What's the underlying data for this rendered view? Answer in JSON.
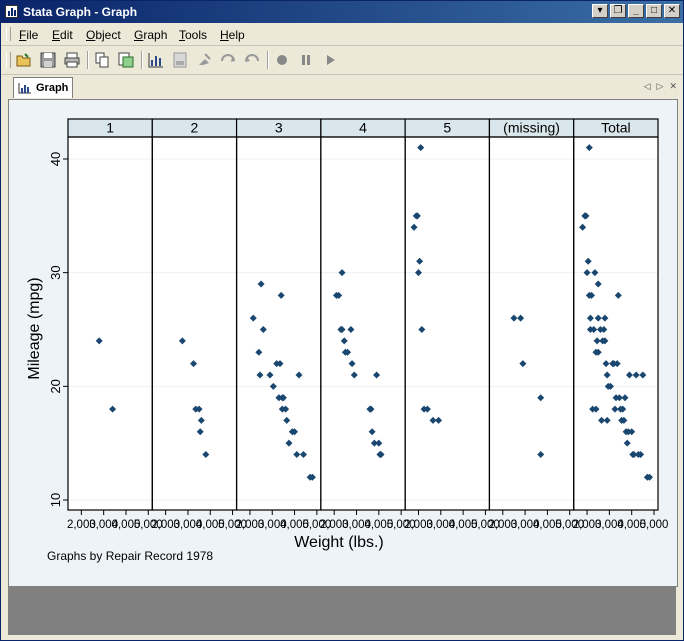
{
  "window": {
    "title": "Stata Graph - Graph"
  },
  "menu": [
    {
      "label": "File",
      "u": "F",
      "rest": "ile"
    },
    {
      "label": "Edit",
      "u": "E",
      "rest": "dit"
    },
    {
      "label": "Object",
      "u": "O",
      "rest": "bject"
    },
    {
      "label": "Graph",
      "u": "G",
      "rest": "raph"
    },
    {
      "label": "Tools",
      "u": "T",
      "rest": "ools"
    },
    {
      "label": "Help",
      "u": "H",
      "rest": "elp"
    }
  ],
  "tab": {
    "label": "Graph"
  },
  "graph": {
    "note": "Graphs by Repair Record 1978"
  },
  "chart_data": {
    "type": "scatter",
    "xlabel": "Weight (lbs.)",
    "ylabel": "Mileage (mpg)",
    "xlim": [
      1760,
      5000
    ],
    "ylim": [
      10,
      41
    ],
    "yticks": [
      10,
      20,
      30,
      40
    ],
    "xticks": [
      2000,
      3000,
      4000,
      5000
    ],
    "xtick_labels": [
      "2,000",
      "3,000",
      "4,000",
      "5,000"
    ],
    "panels": [
      {
        "label": "1",
        "points": [
          [
            2800,
            24
          ],
          [
            3400,
            18
          ]
        ]
      },
      {
        "label": "2",
        "points": [
          [
            2750,
            24
          ],
          [
            3250,
            22
          ],
          [
            3350,
            18
          ],
          [
            3500,
            18
          ],
          [
            3600,
            17
          ],
          [
            3550,
            16
          ],
          [
            3800,
            14
          ]
        ]
      },
      {
        "label": "3",
        "points": [
          [
            2150,
            26
          ],
          [
            2400,
            23
          ],
          [
            2450,
            21
          ],
          [
            2600,
            25
          ],
          [
            2500,
            29
          ],
          [
            2900,
            21
          ],
          [
            3050,
            20
          ],
          [
            3200,
            22
          ],
          [
            3350,
            22
          ],
          [
            3400,
            28
          ],
          [
            3300,
            19
          ],
          [
            3450,
            19
          ],
          [
            3500,
            19
          ],
          [
            3600,
            18
          ],
          [
            3450,
            18
          ],
          [
            3650,
            17
          ],
          [
            3750,
            15
          ],
          [
            3900,
            16
          ],
          [
            4000,
            16
          ],
          [
            4100,
            14
          ],
          [
            4200,
            21
          ],
          [
            4400,
            14
          ],
          [
            4700,
            12
          ],
          [
            4800,
            12
          ]
        ]
      },
      {
        "label": "4",
        "points": [
          [
            2100,
            28
          ],
          [
            2200,
            28
          ],
          [
            2300,
            25
          ],
          [
            2350,
            25
          ],
          [
            2450,
            24
          ],
          [
            2500,
            23
          ],
          [
            2600,
            23
          ],
          [
            2750,
            25
          ],
          [
            2800,
            22
          ],
          [
            2900,
            21
          ],
          [
            2350,
            30
          ],
          [
            3600,
            18
          ],
          [
            3650,
            18
          ],
          [
            3700,
            16
          ],
          [
            3800,
            15
          ],
          [
            3900,
            21
          ],
          [
            4000,
            15
          ],
          [
            4050,
            14
          ],
          [
            4100,
            14
          ]
        ]
      },
      {
        "label": "5",
        "points": [
          [
            1800,
            34
          ],
          [
            1900,
            35
          ],
          [
            1950,
            35
          ],
          [
            2050,
            31
          ],
          [
            2000,
            30
          ],
          [
            2150,
            25
          ],
          [
            2250,
            18
          ],
          [
            2400,
            18
          ],
          [
            2650,
            17
          ],
          [
            2900,
            17
          ],
          [
            2100,
            41
          ]
        ]
      },
      {
        "label": "(missing)",
        "points": [
          [
            2500,
            26
          ],
          [
            2800,
            26
          ],
          [
            2900,
            22
          ],
          [
            3700,
            19
          ],
          [
            3700,
            14
          ]
        ]
      },
      {
        "label": "Total",
        "points": [
          [
            1800,
            34
          ],
          [
            1900,
            35
          ],
          [
            1950,
            35
          ],
          [
            2050,
            31
          ],
          [
            2000,
            30
          ],
          [
            2100,
            41
          ],
          [
            2150,
            25
          ],
          [
            2100,
            28
          ],
          [
            2200,
            28
          ],
          [
            2300,
            25
          ],
          [
            2350,
            30
          ],
          [
            2450,
            24
          ],
          [
            2500,
            23
          ],
          [
            2150,
            26
          ],
          [
            2400,
            23
          ],
          [
            2500,
            29
          ],
          [
            2600,
            25
          ],
          [
            2500,
            26
          ],
          [
            2800,
            26
          ],
          [
            2700,
            24
          ],
          [
            2750,
            25
          ],
          [
            2800,
            24
          ],
          [
            2850,
            22
          ],
          [
            2900,
            21
          ],
          [
            2950,
            20
          ],
          [
            3050,
            20
          ],
          [
            3150,
            22
          ],
          [
            3200,
            22
          ],
          [
            3250,
            18
          ],
          [
            3300,
            19
          ],
          [
            3350,
            22
          ],
          [
            3400,
            28
          ],
          [
            3450,
            19
          ],
          [
            3500,
            18
          ],
          [
            3550,
            17
          ],
          [
            3600,
            18
          ],
          [
            3650,
            17
          ],
          [
            3700,
            19
          ],
          [
            3750,
            16
          ],
          [
            3800,
            15
          ],
          [
            3850,
            16
          ],
          [
            3900,
            21
          ],
          [
            4000,
            16
          ],
          [
            4050,
            14
          ],
          [
            4100,
            14
          ],
          [
            4200,
            21
          ],
          [
            4300,
            14
          ],
          [
            4400,
            14
          ],
          [
            4500,
            21
          ],
          [
            4700,
            12
          ],
          [
            4800,
            12
          ],
          [
            2250,
            18
          ],
          [
            2400,
            18
          ],
          [
            2650,
            17
          ],
          [
            2900,
            17
          ]
        ]
      }
    ]
  }
}
